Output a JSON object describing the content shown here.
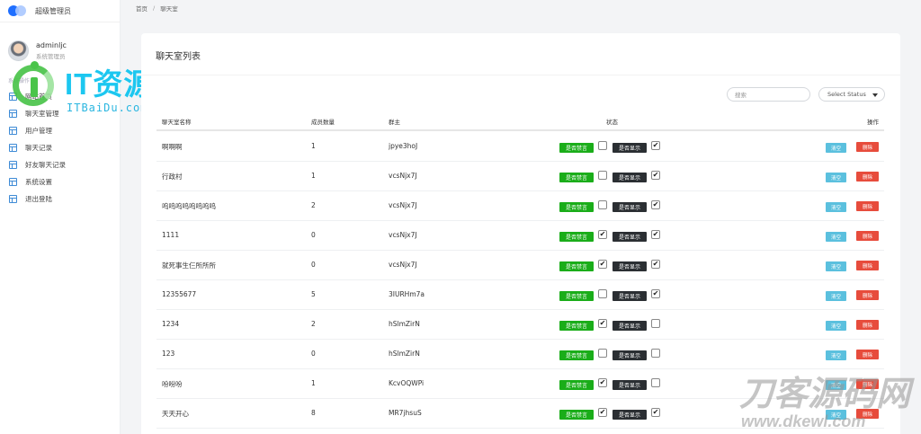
{
  "brand": {
    "title": "超级管理员"
  },
  "user": {
    "name": "adminljc",
    "role": "系统管理员"
  },
  "nav": {
    "section": "系统操作",
    "items": [
      {
        "label": "网站首页"
      },
      {
        "label": "聊天室管理"
      },
      {
        "label": "用户管理"
      },
      {
        "label": "聊天记录"
      },
      {
        "label": "好友聊天记录"
      },
      {
        "label": "系统设置"
      },
      {
        "label": "退出登陆"
      }
    ]
  },
  "breadcrumb": {
    "home": "首页",
    "separator": "/",
    "current": "聊天室"
  },
  "card": {
    "title": "聊天室列表"
  },
  "search": {
    "placeholder": "搜索"
  },
  "status_select": {
    "value": "Select Status"
  },
  "table": {
    "headers": {
      "name": "聊天室名称",
      "count": "成员数量",
      "owner": "群主",
      "status": "状态",
      "actions": "操作"
    },
    "buttons": {
      "mute": "是否禁言",
      "display": "是否显示",
      "clear": "清空",
      "delete": "删除"
    },
    "rows": [
      {
        "name": "啊啊啊",
        "count": "1",
        "owner": "jpye3hoJ",
        "muted": false,
        "shown": true
      },
      {
        "name": "行政村",
        "count": "1",
        "owner": "vcsNjx7J",
        "muted": false,
        "shown": true
      },
      {
        "name": "呜呜呜呜呜呜呜呜",
        "count": "2",
        "owner": "vcsNjx7J",
        "muted": false,
        "shown": true
      },
      {
        "name": "1111",
        "count": "0",
        "owner": "vcsNjx7J",
        "muted": true,
        "shown": true
      },
      {
        "name": "就死事生仨所所所",
        "count": "0",
        "owner": "vcsNjx7J",
        "muted": true,
        "shown": true
      },
      {
        "name": "12355677",
        "count": "5",
        "owner": "3IURHm7a",
        "muted": false,
        "shown": true
      },
      {
        "name": "1234",
        "count": "2",
        "owner": "hSlmZirN",
        "muted": true,
        "shown": false
      },
      {
        "name": "123",
        "count": "0",
        "owner": "hSlmZirN",
        "muted": false,
        "shown": false
      },
      {
        "name": "吩吩吩",
        "count": "1",
        "owner": "KcvOQWPi",
        "muted": true,
        "shown": false
      },
      {
        "name": "天天开心",
        "count": "8",
        "owner": "MR7jhsuS",
        "muted": true,
        "shown": true
      }
    ]
  },
  "watermarks": {
    "it_main": "IT资源网",
    "it_sub": "ITBaiDu.com",
    "dk_main": "刀客源码网",
    "dk_sub": "www.dkewl.com"
  }
}
